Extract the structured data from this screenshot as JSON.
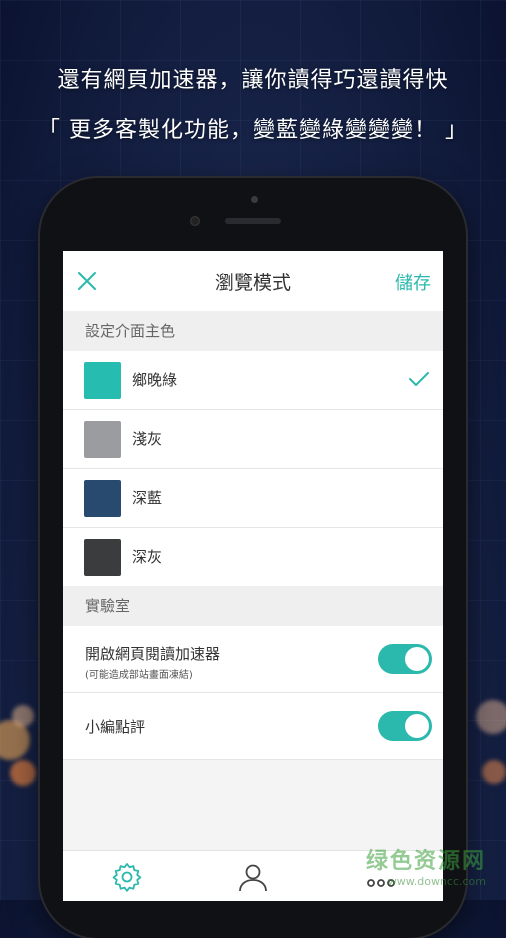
{
  "promo": {
    "line1": "還有網頁加速器，讓你讀得巧還讀得快",
    "line2": "「 更多客製化功能，變藍變綠變變變！ 」"
  },
  "header": {
    "title": "瀏覽模式",
    "save_label": "儲存",
    "close_icon": "close-icon"
  },
  "theme_section": {
    "heading": "設定介面主色",
    "options": [
      {
        "label": "鄉晚綠",
        "color": "#27bcb0",
        "selected": true
      },
      {
        "label": "淺灰",
        "color": "#9a9c9f",
        "selected": false
      },
      {
        "label": "深藍",
        "color": "#274a6e",
        "selected": false
      },
      {
        "label": "深灰",
        "color": "#3b3c3e",
        "selected": false
      }
    ]
  },
  "lab_section": {
    "heading": "實驗室",
    "items": [
      {
        "label": "開啟網頁閱讀加速器",
        "sublabel": "(可能造成部站畫面凍結)",
        "enabled": true
      },
      {
        "label": "小編點評",
        "enabled": true
      }
    ]
  },
  "tabbar": {
    "items": [
      "gear-icon",
      "user-icon",
      "more-icon"
    ]
  },
  "watermark": {
    "line1": "绿色资源网",
    "line2": "www.downcc.com"
  },
  "colors": {
    "accent": "#2bb9ad"
  }
}
